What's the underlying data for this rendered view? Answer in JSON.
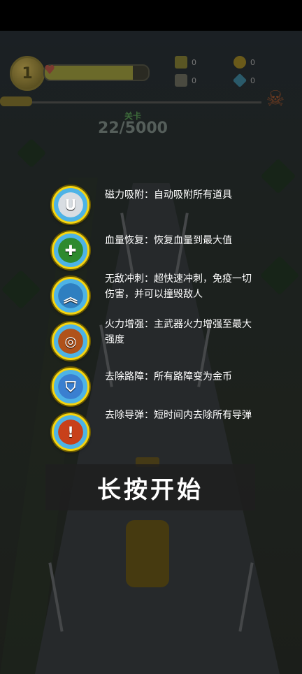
{
  "hud": {
    "level": "1",
    "hp_level": 0.85,
    "resource_a_count": "0",
    "resource_b_count": "0",
    "coin_count": "0",
    "gem_count": "0",
    "mission_label": "关卡",
    "mission_progress": "22/5000"
  },
  "powerups": [
    {
      "icon": "magnet-icon",
      "ring_color": "#4db3e6",
      "inner_color": "#d8dde2",
      "glyph": "U",
      "description": "磁力吸附：自动吸附所有道具"
    },
    {
      "icon": "green-cross-icon",
      "ring_color": "#4db3e6",
      "inner_color": "#2e8a2e",
      "glyph": "✚",
      "description": "血量恢复：恢复血量到最大值"
    },
    {
      "icon": "chevrons-up-icon",
      "ring_color": "#4db3e6",
      "inner_color": "#2f7fc0",
      "glyph": "︽",
      "description": "无敌冲刺：超快速冲刺，免疫一切伤害，并可以撞毁敌人"
    },
    {
      "icon": "target-crosshair-icon",
      "ring_color": "#4db3e6",
      "inner_color": "#b0521a",
      "glyph": "◎",
      "description": "火力增强：主武器火力增强至最大强度"
    },
    {
      "icon": "shield-icon",
      "ring_color": "#4db3e6",
      "inner_color": "#3a7fd0",
      "glyph": "⛉",
      "description": "去除路障：所有路障变为金币"
    },
    {
      "icon": "exclamation-icon",
      "ring_color": "#4db3e6",
      "inner_color": "#c8401a",
      "glyph": "!",
      "description": "去除导弹：短时间内去除所有导弹"
    }
  ],
  "start_button": {
    "label": "长按开始"
  },
  "colors": {
    "icon_border": "#f6d410",
    "panel_bg": "#1e1e1e",
    "text": "#ffffff"
  }
}
